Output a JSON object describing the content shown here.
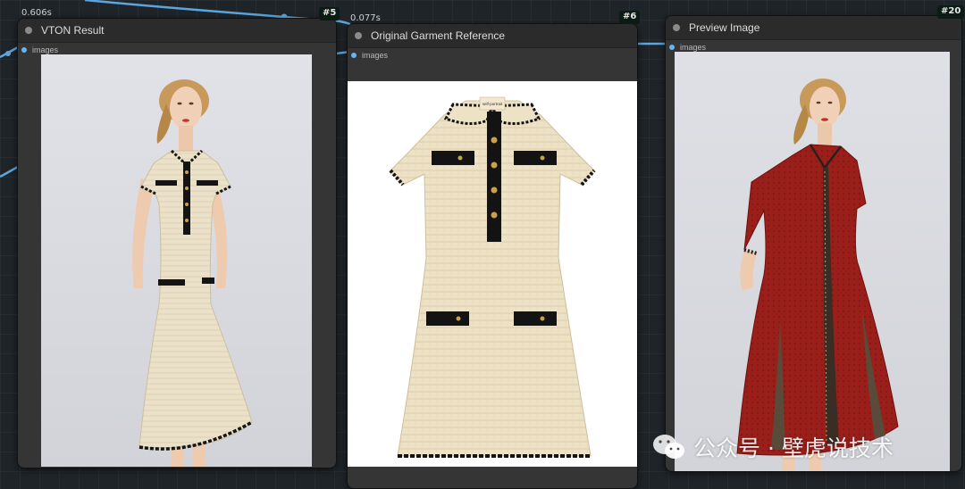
{
  "nodes": [
    {
      "id_badge": "#5",
      "title": "VTON Result",
      "timing": "0.606s",
      "slot_label": "images",
      "image": {
        "garment_color": "#ebe1c9",
        "trim_color": "#131313",
        "background": "#dcdde2"
      }
    },
    {
      "id_badge": "#6",
      "title": "Original Garment Reference",
      "timing": "0.077s",
      "slot_label": "images",
      "image": {
        "garment_color": "#eee2c6",
        "trim_color": "#111111",
        "background": "#ffffff",
        "tag_text": "self-portrait"
      }
    },
    {
      "id_badge": "#20",
      "title": "Preview Image",
      "timing": "",
      "slot_label": "images",
      "image": {
        "garment_color": "#9a1f1a",
        "trim_color": "#2a201a",
        "background": "#dadbe0"
      }
    }
  ],
  "watermark": {
    "text": "公众号 · 壁虎说技术",
    "icon": "wechat-icon"
  },
  "colors": {
    "canvas": "#1f2429",
    "node_body": "#353535",
    "node_header": "#2b2b2b",
    "link": "#64b5f6",
    "badge": "#0b1c14"
  }
}
